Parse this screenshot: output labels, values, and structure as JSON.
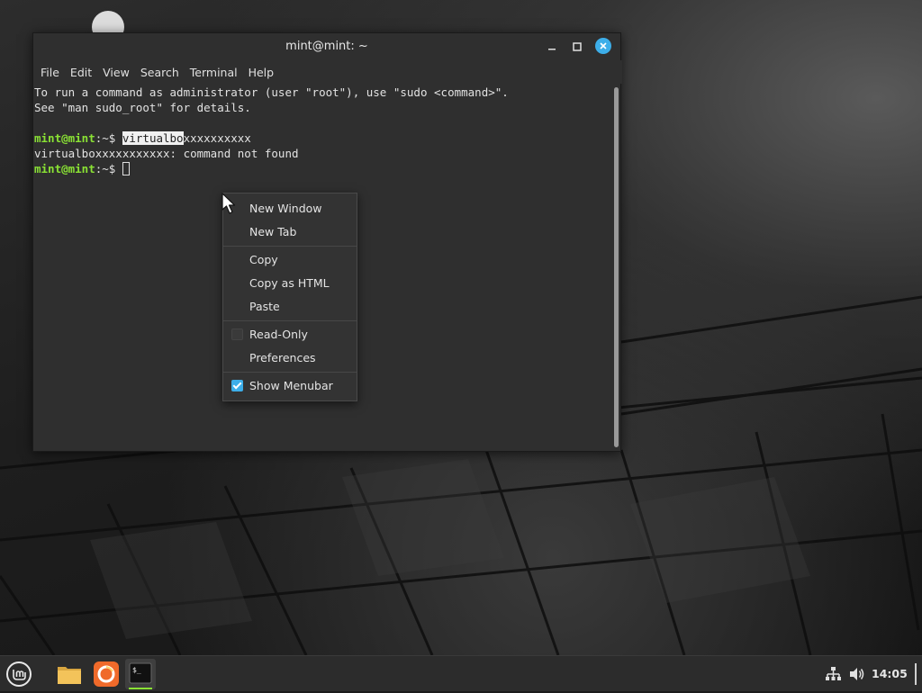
{
  "window": {
    "title": "mint@mint: ~"
  },
  "menubar": {
    "items": [
      "File",
      "Edit",
      "View",
      "Search",
      "Terminal",
      "Help"
    ]
  },
  "terminal": {
    "line1": "To run a command as administrator (user \"root\"), use \"sudo <command>\".",
    "line2": "See \"man sudo_root\" for details.",
    "prompt_user": "mint@mint",
    "prompt_path": ":~$ ",
    "cmd_selected": "virtualbo",
    "cmd_rest": "xxxxxxxxxx",
    "error": "virtualboxxxxxxxxxxx: command not found"
  },
  "context_menu": {
    "new_window": "New Window",
    "new_tab": "New Tab",
    "copy": "Copy",
    "copy_html": "Copy as HTML",
    "paste": "Paste",
    "read_only": "Read-Only",
    "preferences": "Preferences",
    "show_menubar": "Show Menubar",
    "read_only_checked": false,
    "show_menubar_checked": true
  },
  "panel": {
    "clock": "14:05"
  },
  "colors": {
    "accent": "#3daee9",
    "prompt": "#8ae234",
    "terminal_bg": "#2f2f2f"
  }
}
